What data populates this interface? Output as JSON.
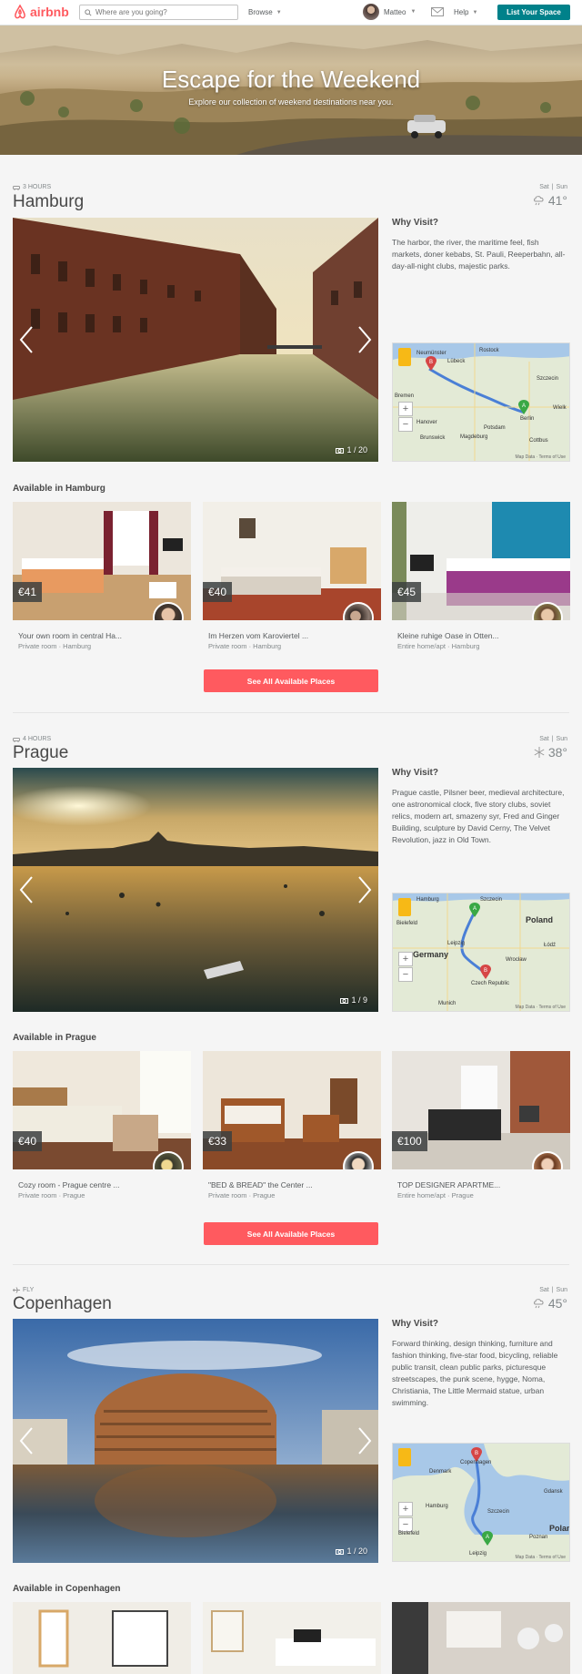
{
  "header": {
    "logo_text": "airbnb",
    "search_placeholder": "Where are you going?",
    "browse_label": "Browse",
    "user_name": "Matteo",
    "help_label": "Help",
    "list_space_label": "List Your Space"
  },
  "hero": {
    "title": "Escape for the Weekend",
    "subtitle": "Explore our collection of weekend destinations near you."
  },
  "destinations": [
    {
      "travel": "3 HOURS",
      "city": "Hamburg",
      "day1": "Sat",
      "day2": "Sun",
      "temp": "41°",
      "counter": "1 / 20",
      "why_title": "Why Visit?",
      "why_text": "The harbor, the river, the maritime feel, fish markets, doner kebabs, St. Pauli, Reeperbahn, all-day-all-night clubs, majestic parks.",
      "map_labels": [
        "Neumünster",
        "Rostock",
        "Lübeck",
        "Bremen",
        "Hanover",
        "Potsdam",
        "Brunswick",
        "Szczecin",
        "Berlin",
        "Wielk",
        "Cottbus",
        "Magdeburg"
      ],
      "available_title": "Available in Hamburg",
      "listings": [
        {
          "price": "€41",
          "title": "Your own room in central Ha...",
          "sub": "Private room · Hamburg"
        },
        {
          "price": "€40",
          "title": "Im Herzen vom Karoviertel ...",
          "sub": "Private room · Hamburg"
        },
        {
          "price": "€45",
          "title": "Kleine ruhige Oase in Otten...",
          "sub": "Entire home/apt · Hamburg"
        }
      ],
      "see_all": "See All Available Places"
    },
    {
      "travel": "4 HOURS",
      "city": "Prague",
      "day1": "Sat",
      "day2": "Sun",
      "temp": "38°",
      "counter": "1 / 9",
      "why_title": "Why Visit?",
      "why_text": "Prague castle, Pilsner beer, medieval architecture, one astronomical clock, five story clubs, soviet relics, modern art, smazeny syr, Fred and Ginger Building, sculpture by David Cerny, The Velvet Revolution, jazz in Old Town.",
      "map_labels": [
        "Hamburg",
        "Szczecin",
        "Poland",
        "Bielefeld",
        "Germany",
        "Leipzig",
        "Łódź",
        "Wrocław",
        "Czech Republic",
        "Munich"
      ],
      "available_title": "Available in Prague",
      "listings": [
        {
          "price": "€40",
          "title": "Cozy room - Prague centre ...",
          "sub": "Private room · Prague"
        },
        {
          "price": "€33",
          "title": "\"BED & BREAD\" the Center ...",
          "sub": "Private room · Prague"
        },
        {
          "price": "€100",
          "title": "TOP DESIGNER APARTME...",
          "sub": "Entire home/apt · Prague"
        }
      ],
      "see_all": "See All Available Places"
    },
    {
      "travel": "FLY",
      "city": "Copenhagen",
      "day1": "Sat",
      "day2": "Sun",
      "temp": "45°",
      "counter": "1 / 20",
      "why_title": "Why Visit?",
      "why_text": "Forward thinking, design thinking, furniture and fashion thinking, five-star food, bicycling, reliable public transit, clean public parks, picturesque streetscapes, the punk scene, hygge, Noma, Christiania, The Little Mermaid statue, urban swimming.",
      "map_labels": [
        "Copenhagen",
        "Denmark",
        "Gdansk",
        "Hamburg",
        "Szczecin",
        "Bielefeld",
        "Poznan",
        "Polan",
        "Leipzig"
      ],
      "available_title": "Available in Copenhagen"
    }
  ],
  "colors": {
    "brand": "#ff5a5f",
    "teal": "#00818a"
  }
}
